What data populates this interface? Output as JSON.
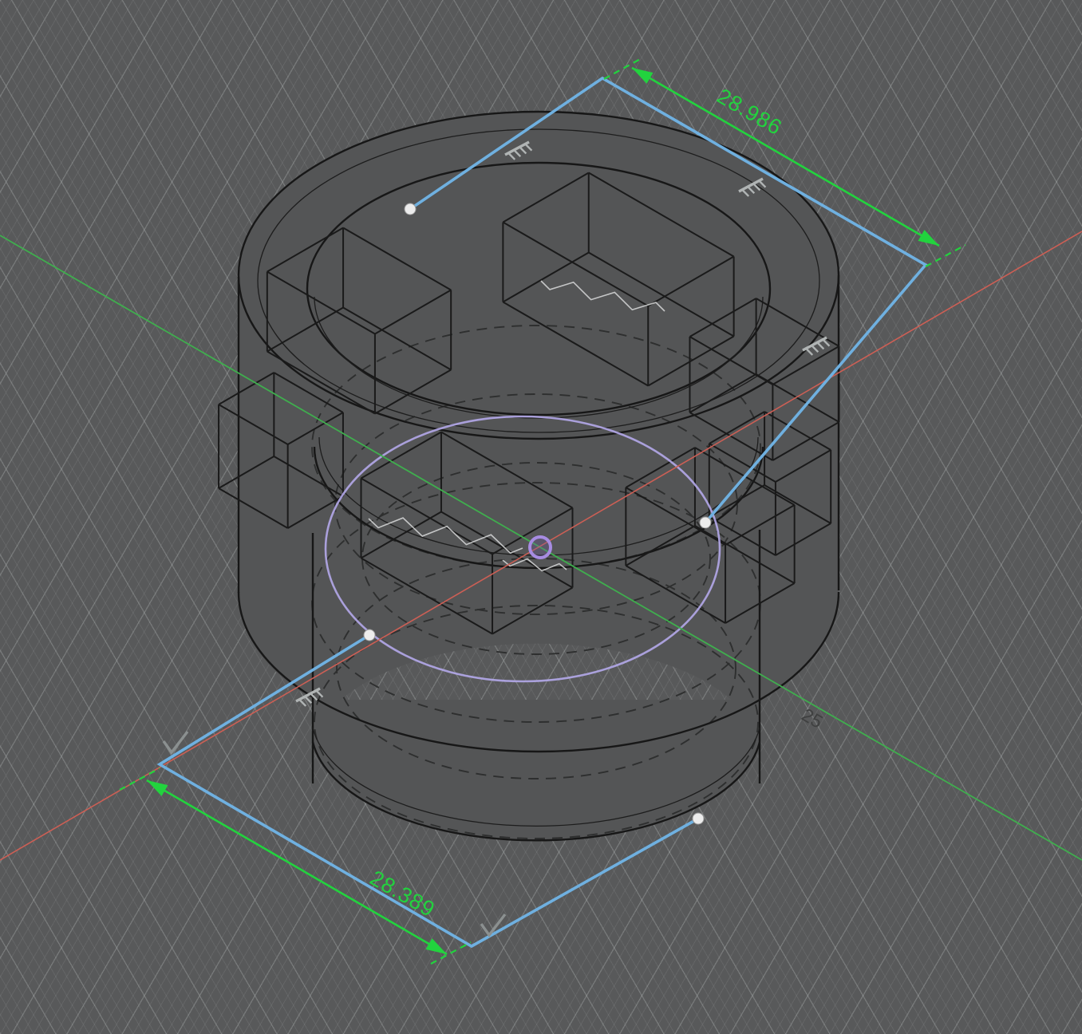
{
  "viewport": {
    "type": "cad-3d-viewport",
    "view_orientation": "isometric",
    "background_color": "#58595a",
    "grid_minor_color": "#696b6b",
    "grid_major_color": "#7a7c7c"
  },
  "model": {
    "name": "notched cylinder body",
    "body_fill_color": "#545556",
    "edge_color": "#171717",
    "hidden_edge_style": "dashed",
    "visible_notch_count": 7
  },
  "sketch": {
    "line_color": "#6fb0e0",
    "selected_circle_color": "#b4a8ea",
    "point_color": "#ececec",
    "visible_point_count": 4,
    "origin_ring_color": "#a78ce2"
  },
  "axes": {
    "x_axis_color": "#cc5f55",
    "y_axis_color": "#3fae4e"
  },
  "dimensions": {
    "accent_color": "#22d33e",
    "top": {
      "label": "28.986"
    },
    "bottom": {
      "label": "28.389"
    },
    "height": {
      "label": "25",
      "text_color": "#3f4040"
    }
  },
  "icons": {
    "fix_constraint_count": 4,
    "check_constraint_count": 2
  }
}
